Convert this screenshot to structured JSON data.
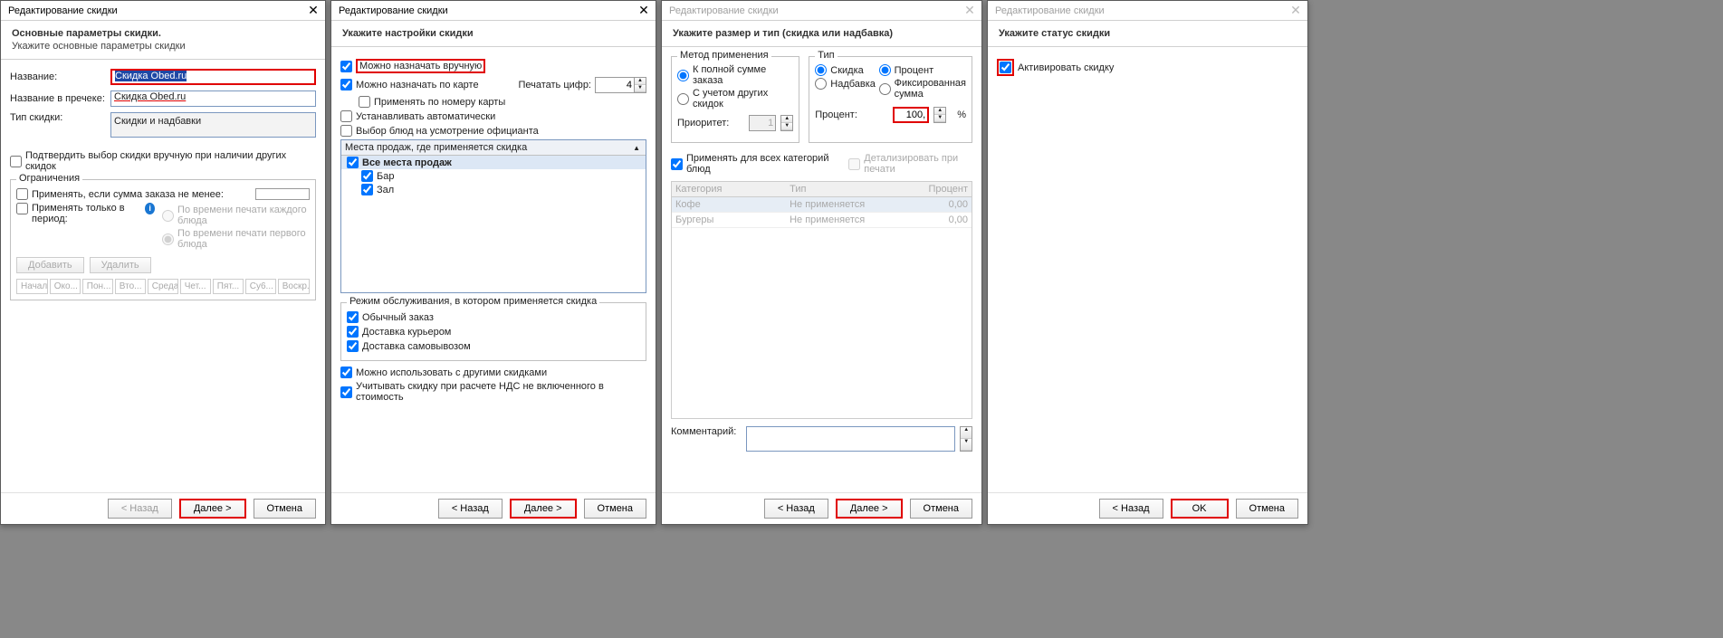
{
  "dialogs": {
    "title": "Редактирование скидки",
    "close": "✕",
    "buttons": {
      "back": "< Назад",
      "next": "Далее >",
      "cancel": "Отмена",
      "ok": "OK"
    }
  },
  "d1": {
    "h1": "Основные параметры скидки.",
    "h2": "Укажите основные параметры скидки",
    "name_lbl": "Название:",
    "name_val": "Скидка Obed.ru",
    "precheck_lbl": "Название в пречеке:",
    "precheck_val": "Скидка Obed.ru",
    "type_lbl": "Тип скидки:",
    "type_val": "Скидки и надбавки",
    "confirm": "Подтвердить выбор скидки вручную при наличии других скидок",
    "restrict_legend": "Ограничения",
    "apply_min": "Применять, если сумма заказа не менее:",
    "apply_period": "Применять только в период:",
    "by_print_each": "По времени печати каждого блюда",
    "by_print_first": "По времени печати первого блюда",
    "add": "Добавить",
    "del": "Удалить",
    "days": [
      "Начало",
      "Око...",
      "Пон...",
      "Вто...",
      "Среда",
      "Чет...",
      "Пят...",
      "Су6...",
      "Воскр..."
    ]
  },
  "d2": {
    "h1": "Укажите настройки скидки",
    "manual": "Можно назначать вручную",
    "by_card": "Можно назначать по карте",
    "by_card_num": "Применять по номеру карты",
    "print_digits_lbl": "Печатать цифр:",
    "print_digits_val": "4",
    "auto": "Устанавливать автоматически",
    "waiter": "Выбор блюд на усмотрение официанта",
    "places_hdr": "Места продаж, где применяется скидка",
    "places": {
      "all": "Все места продаж",
      "bar": "Бар",
      "hall": "Зал"
    },
    "mode_legend": "Режим обслуживания, в котором применяется скидка",
    "mode_normal": "Обычный заказ",
    "mode_courier": "Доставка курьером",
    "mode_self": "Доставка самовывозом",
    "other_disc": "Можно использовать с другими скидками",
    "vat": "Учитывать скидку при расчете НДС не включенного в стоимость"
  },
  "d3": {
    "h1": "Укажите размер и тип (скидка или надбавка)",
    "method_legend": "Метод применения",
    "m_full": "К полной сумме заказа",
    "m_other": "С учетом других скидок",
    "priority_lbl": "Приоритет:",
    "priority_val": "1",
    "type_legend": "Тип",
    "t_discount": "Скидка",
    "t_percent": "Процент",
    "t_surcharge": "Надбавка",
    "t_fixed": "Фиксированная сумма",
    "percent_lbl": "Процент:",
    "percent_val": "100,",
    "percent_unit": "%",
    "apply_all": "Применять для всех категорий блюд",
    "detail_print": "Детализировать при печати",
    "th_cat": "Категория",
    "th_type": "Тип",
    "th_pct": "Процент",
    "rows": [
      {
        "cat": "Кофе",
        "type": "Не применяется",
        "pct": "0,00"
      },
      {
        "cat": "Бургеры",
        "type": "Не применяется",
        "pct": "0,00"
      }
    ],
    "comment_lbl": "Комментарий:"
  },
  "d4": {
    "h1": "Укажите статус скидки",
    "activate": "Активировать скидку"
  }
}
